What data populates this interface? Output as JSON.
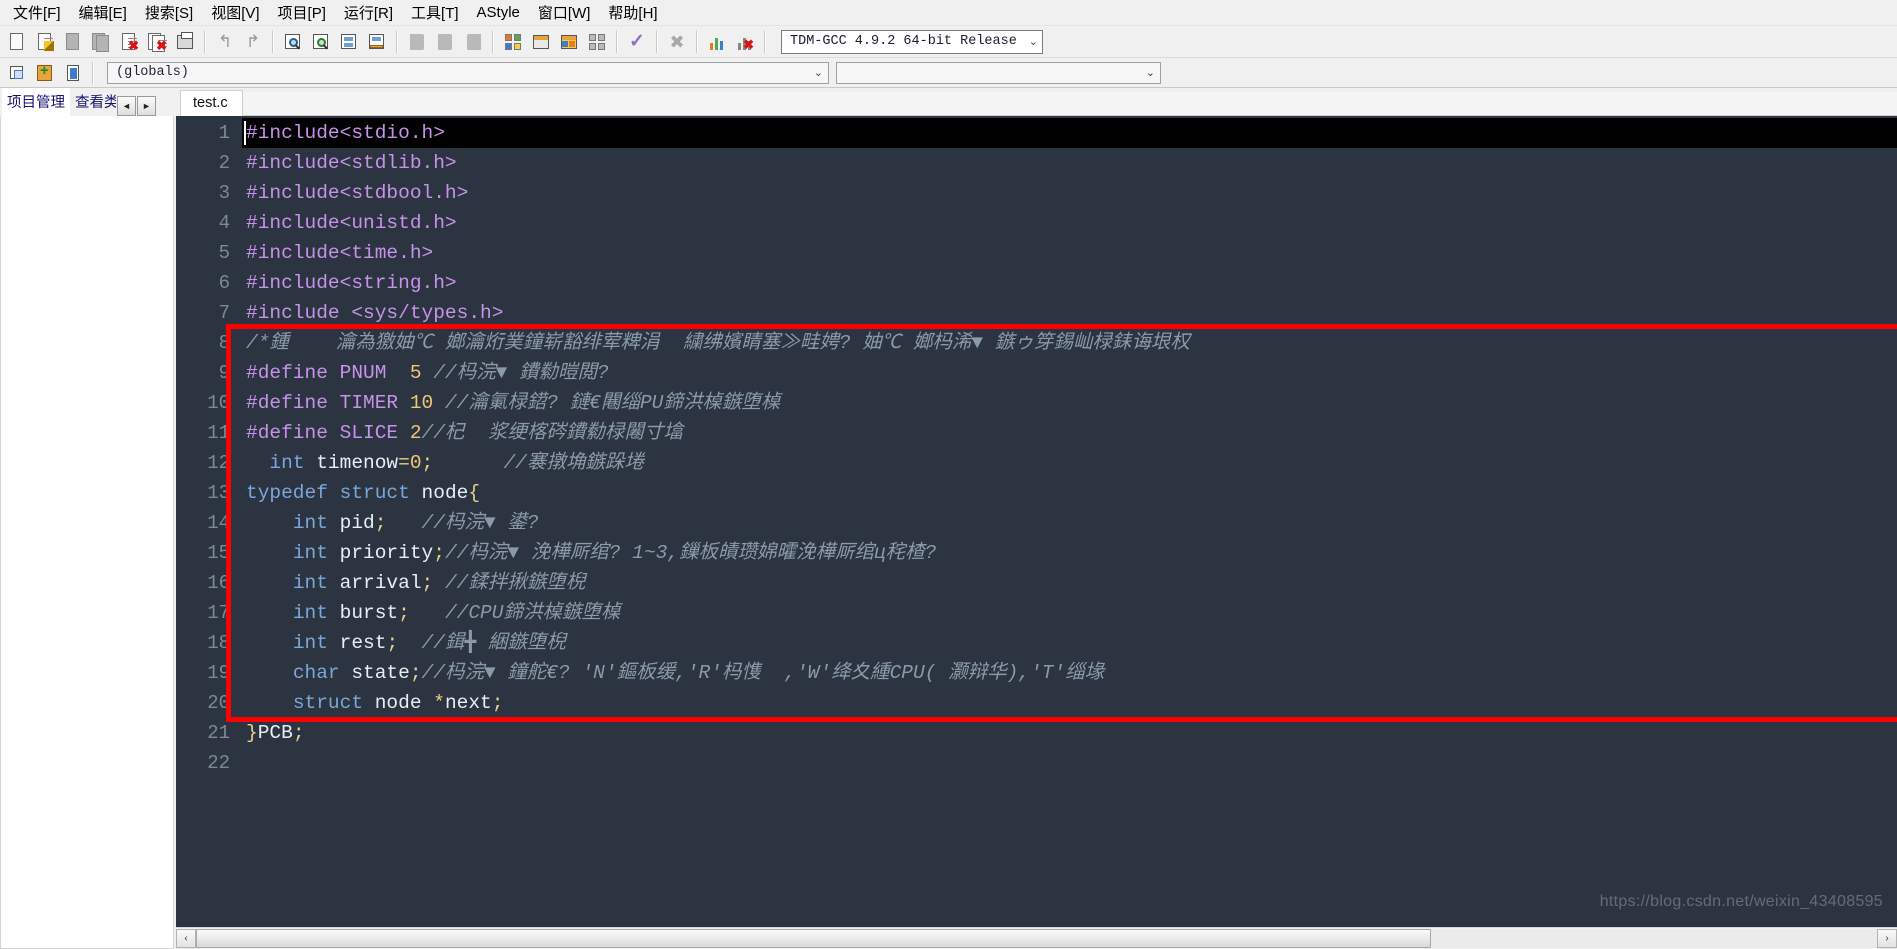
{
  "menu": {
    "items": [
      {
        "name": "file",
        "label": "文件[F]"
      },
      {
        "name": "edit",
        "label": "编辑[E]"
      },
      {
        "name": "search",
        "label": "搜索[S]"
      },
      {
        "name": "view",
        "label": "视图[V]"
      },
      {
        "name": "project",
        "label": "项目[P]"
      },
      {
        "name": "run",
        "label": "运行[R]"
      },
      {
        "name": "tools",
        "label": "工具[T]"
      },
      {
        "name": "astyle",
        "label": "AStyle"
      },
      {
        "name": "window",
        "label": "窗口[W]"
      },
      {
        "name": "help",
        "label": "帮助[H]"
      }
    ]
  },
  "toolbar": {
    "icons": [
      "new-file-icon",
      "open-file-icon",
      "save-file-icon",
      "save-all-icon",
      "close-file-icon",
      "close-all-icon",
      "print-icon",
      "undo-icon",
      "redo-icon",
      "find-icon",
      "replace-icon",
      "goto-line-icon",
      "goto-function-icon",
      "back-icon",
      "forward-icon",
      "toggle-icon",
      "compile-icon",
      "run-icon",
      "compile-run-icon",
      "rebuild-all-icon",
      "syntax-check-icon",
      "stop-icon",
      "profile-icon",
      "debug-icon"
    ],
    "compiler_set": "TDM-GCC 4.9.2 64-bit Release"
  },
  "toolbar2": {
    "icons": [
      "insert-icon",
      "toggle-bookmark-icon",
      "goto-bookmark-icon"
    ],
    "scope": "(globals)",
    "member": ""
  },
  "leftdock": {
    "tabs": [
      {
        "name": "project-manager",
        "label": "项目管理"
      },
      {
        "name": "class-browser",
        "label": "查看类"
      }
    ],
    "spin_prev": "◄",
    "spin_next": "►"
  },
  "editor": {
    "tabs": [
      {
        "name": "test-c",
        "label": "test.c"
      }
    ],
    "current_line": 1,
    "lines": [
      {
        "n": 1,
        "tokens": [
          {
            "t": "#include<stdio.h>",
            "c": "kw"
          }
        ],
        "current": true
      },
      {
        "n": 2,
        "tokens": [
          {
            "t": "#include<stdlib.h>",
            "c": "kw"
          }
        ]
      },
      {
        "n": 3,
        "tokens": [
          {
            "t": "#include<stdbool.h>",
            "c": "kw"
          }
        ]
      },
      {
        "n": 4,
        "tokens": [
          {
            "t": "#include<unistd.h>",
            "c": "kw"
          }
        ]
      },
      {
        "n": 5,
        "tokens": [
          {
            "t": "#include<time.h>",
            "c": "kw"
          }
        ]
      },
      {
        "n": 6,
        "tokens": [
          {
            "t": "#include<string.h>",
            "c": "kw"
          }
        ]
      },
      {
        "n": 7,
        "tokens": [
          {
            "t": "#include <sys/types.h>",
            "c": "kw"
          }
        ]
      },
      {
        "n": 8,
        "tokens": [
          {
            "t": "/*鍾    瀹為獥妯℃ 嫏瀹烆菐鐘崭豁绯荤粺涓  繍绋嬪睛塞≫畦娉? 妯℃ 嫏杩浠▼ 鏃ゥ笌錫屾椂銇诲垠权",
            "c": "cmt"
          }
        ]
      },
      {
        "n": 9,
        "tokens": [
          {
            "t": "#define PNUM  ",
            "c": "kw"
          },
          {
            "t": "5",
            "c": "num"
          },
          {
            "t": " //杩浣▼ 鐨勬暟閲?",
            "c": "cmt"
          }
        ]
      },
      {
        "n": 10,
        "tokens": [
          {
            "t": "#define TIMER ",
            "c": "kw"
          },
          {
            "t": "10",
            "c": "num"
          },
          {
            "t": " //瀹氭椂鍣? 鏈€闀缁PU鍗洪槕鏃堕槕",
            "c": "cmt"
          }
        ]
      },
      {
        "n": 11,
        "tokens": [
          {
            "t": "#define SLICE ",
            "c": "kw"
          },
          {
            "t": "2",
            "c": "num"
          },
          {
            "t": "//杞  浆绠楁硶鐨勬椂闂寸墖",
            "c": "cmt"
          }
        ]
      },
      {
        "n": 12,
        "tokens": [
          {
            "t": "  ",
            "c": "id"
          },
          {
            "t": "int",
            "c": "kw2"
          },
          {
            "t": " ",
            "c": "id"
          },
          {
            "t": "timenow",
            "c": "white"
          },
          {
            "t": "=",
            "c": "punc"
          },
          {
            "t": "0",
            "c": "num"
          },
          {
            "t": ";",
            "c": "punc"
          },
          {
            "t": "      //褰撴埆鏃跺埢",
            "c": "cmt"
          }
        ]
      },
      {
        "n": 13,
        "tokens": [
          {
            "t": "typedef",
            "c": "kw2"
          },
          {
            "t": " ",
            "c": "id"
          },
          {
            "t": "struct",
            "c": "kw2"
          },
          {
            "t": " ",
            "c": "id"
          },
          {
            "t": "node",
            "c": "white"
          },
          {
            "t": "{",
            "c": "punc"
          }
        ],
        "fold": "start"
      },
      {
        "n": 14,
        "tokens": [
          {
            "t": "    ",
            "c": "id"
          },
          {
            "t": "int",
            "c": "kw2"
          },
          {
            "t": " ",
            "c": "id"
          },
          {
            "t": "pid",
            "c": "white"
          },
          {
            "t": ";",
            "c": "punc"
          },
          {
            "t": "   //杩浣▼ 鍙?",
            "c": "cmt"
          }
        ]
      },
      {
        "n": 15,
        "tokens": [
          {
            "t": "    ",
            "c": "id"
          },
          {
            "t": "int",
            "c": "kw2"
          },
          {
            "t": " ",
            "c": "id"
          },
          {
            "t": "priority",
            "c": "white"
          },
          {
            "t": ";",
            "c": "punc"
          },
          {
            "t": "//杩浣▼ 浼樺厛绾? 1~3,鏁板皟瓒婂曤浼樺厛绾ц秺楂?",
            "c": "cmt"
          }
        ]
      },
      {
        "n": 16,
        "tokens": [
          {
            "t": "    ",
            "c": "id"
          },
          {
            "t": "int",
            "c": "kw2"
          },
          {
            "t": " ",
            "c": "id"
          },
          {
            "t": "arrival",
            "c": "white"
          },
          {
            "t": ";",
            "c": "punc"
          },
          {
            "t": " //鍒拌揪鏃堕棿",
            "c": "cmt"
          }
        ]
      },
      {
        "n": 17,
        "tokens": [
          {
            "t": "    ",
            "c": "id"
          },
          {
            "t": "int",
            "c": "kw2"
          },
          {
            "t": " ",
            "c": "id"
          },
          {
            "t": "burst",
            "c": "white"
          },
          {
            "t": ";",
            "c": "punc"
          },
          {
            "t": "   //CPU鍗洪槕鏃堕槕",
            "c": "cmt"
          }
        ]
      },
      {
        "n": 18,
        "tokens": [
          {
            "t": "    ",
            "c": "id"
          },
          {
            "t": "int",
            "c": "kw2"
          },
          {
            "t": " ",
            "c": "id"
          },
          {
            "t": "rest",
            "c": "white"
          },
          {
            "t": ";",
            "c": "punc"
          },
          {
            "t": "  //鍓╋ 綑鏃堕棿",
            "c": "cmt"
          }
        ]
      },
      {
        "n": 19,
        "tokens": [
          {
            "t": "    ",
            "c": "id"
          },
          {
            "t": "char",
            "c": "kw2"
          },
          {
            "t": " ",
            "c": "id"
          },
          {
            "t": "state",
            "c": "white"
          },
          {
            "t": ";",
            "c": "punc"
          },
          {
            "t": "//杩浣▼ 鐘舵€? 'N'鏂板缓,'R'杩愯  ,'W'绛夊緟CPU( 灏辩华),'T'缁堟",
            "c": "cmt"
          }
        ]
      },
      {
        "n": 20,
        "tokens": [
          {
            "t": "    ",
            "c": "id"
          },
          {
            "t": "struct",
            "c": "kw2"
          },
          {
            "t": " ",
            "c": "id"
          },
          {
            "t": "node",
            "c": "white"
          },
          {
            "t": " ",
            "c": "id"
          },
          {
            "t": "*",
            "c": "punc"
          },
          {
            "t": "next",
            "c": "white"
          },
          {
            "t": ";",
            "c": "punc"
          }
        ]
      },
      {
        "n": 21,
        "tokens": [
          {
            "t": "}",
            "c": "punc"
          },
          {
            "t": "PCB",
            "c": "white"
          },
          {
            "t": ";",
            "c": "punc"
          }
        ],
        "fold": "end"
      },
      {
        "n": 22,
        "tokens": []
      }
    ]
  },
  "annotation": {
    "name": "red-highlight-box",
    "color": "#fe0000",
    "covers_lines": "8-20"
  },
  "scrollbar": {
    "left_arrow": "‹",
    "right_arrow": "›"
  },
  "watermark": "https://blog.csdn.net/weixin_43408595"
}
